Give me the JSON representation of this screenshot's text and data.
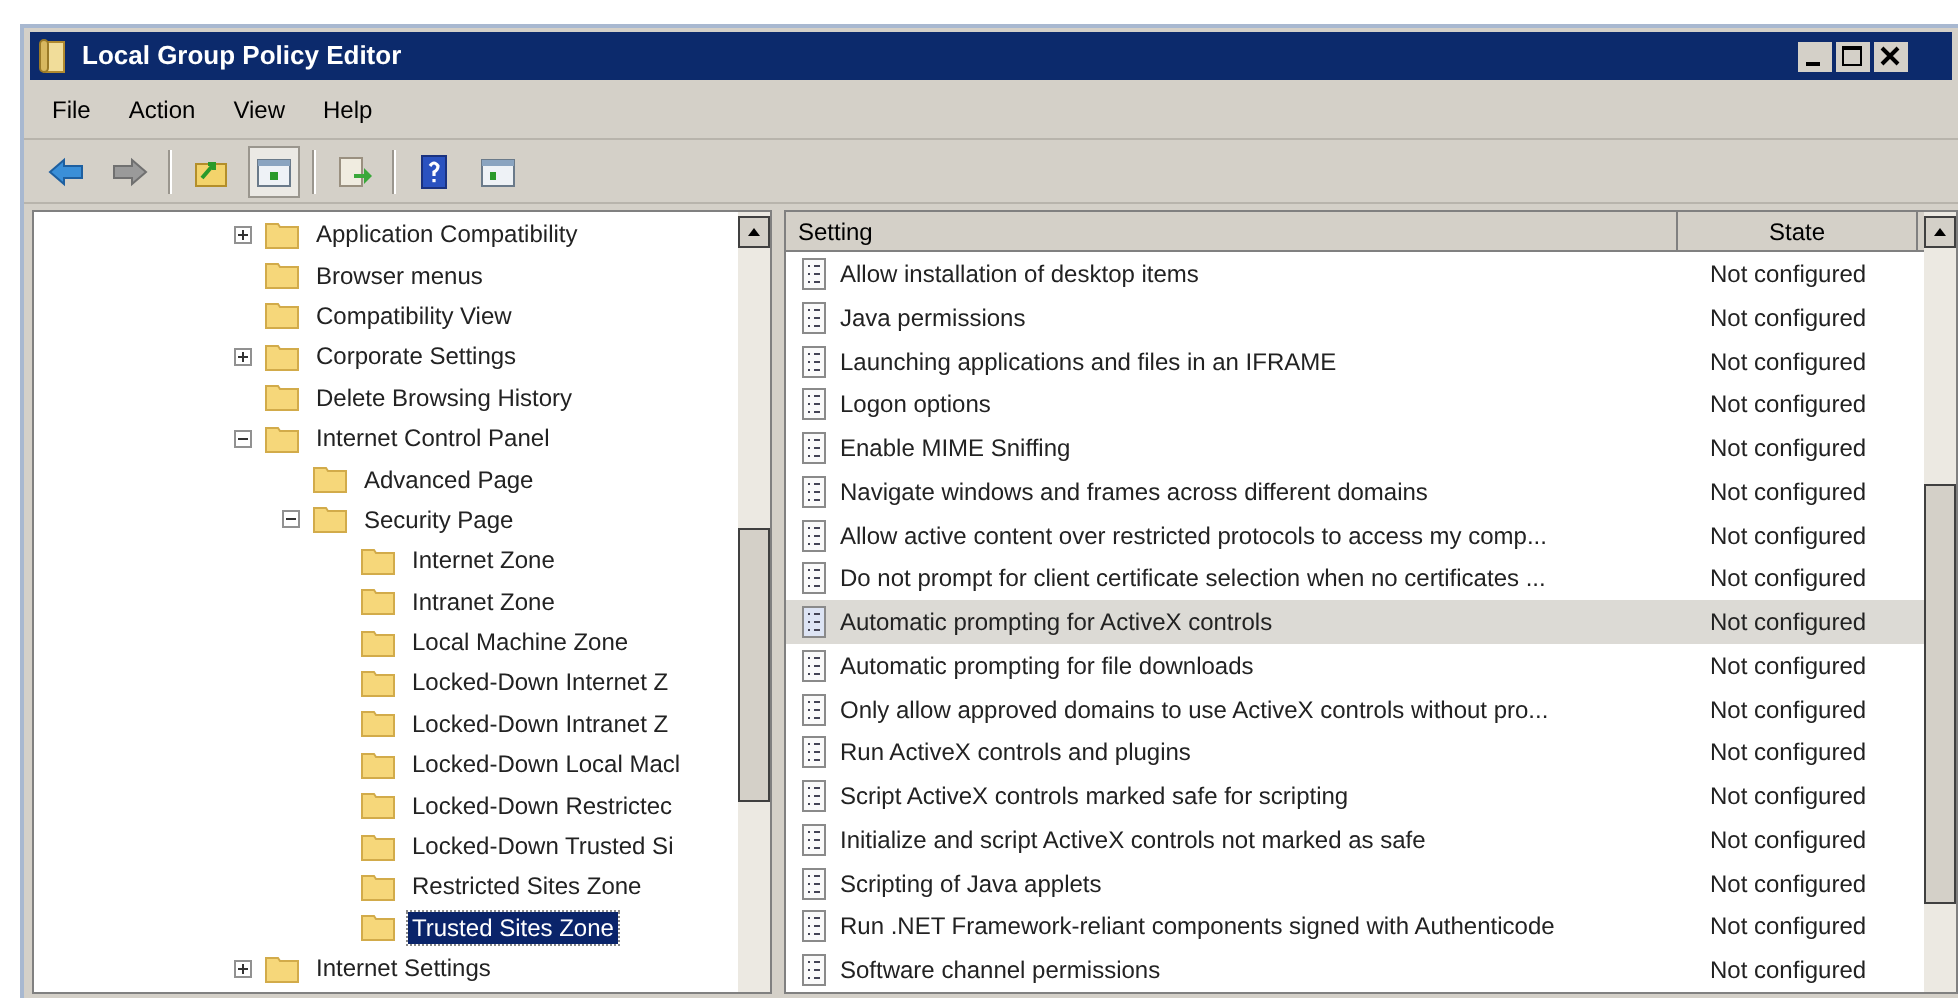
{
  "window": {
    "title": "Local Group Policy Editor"
  },
  "menu": [
    "File",
    "Action",
    "View",
    "Help"
  ],
  "toolbar": [
    {
      "kind": "back",
      "pressed": false
    },
    {
      "kind": "forward",
      "pressed": false
    },
    {
      "kind": "separator"
    },
    {
      "kind": "up",
      "pressed": false
    },
    {
      "kind": "tree",
      "pressed": true
    },
    {
      "kind": "separator"
    },
    {
      "kind": "export",
      "pressed": false
    },
    {
      "kind": "separator"
    },
    {
      "kind": "help",
      "pressed": false
    },
    {
      "kind": "pane",
      "pressed": false
    }
  ],
  "tree": [
    {
      "label": "Application Compatibility",
      "expanded": false,
      "selected": false
    },
    {
      "label": "Browser menus",
      "selected": false
    },
    {
      "label": "Compatibility View",
      "selected": false
    },
    {
      "label": "Corporate Settings",
      "expanded": false,
      "selected": false
    },
    {
      "label": "Delete Browsing History",
      "selected": false
    },
    {
      "label": "Internet Control Panel",
      "expanded": true,
      "selected": false,
      "children": [
        {
          "label": "Advanced Page",
          "selected": false
        },
        {
          "label": "Security Page",
          "expanded": true,
          "selected": false,
          "children": [
            {
              "label": "Internet Zone",
              "selected": false
            },
            {
              "label": "Intranet Zone",
              "selected": false
            },
            {
              "label": "Local Machine Zone",
              "selected": false
            },
            {
              "label": "Locked-Down Internet Z",
              "selected": false
            },
            {
              "label": "Locked-Down Intranet Z",
              "selected": false
            },
            {
              "label": "Locked-Down Local Macl",
              "selected": false
            },
            {
              "label": "Locked-Down Restrictec",
              "selected": false
            },
            {
              "label": "Locked-Down Trusted Si",
              "selected": false
            },
            {
              "label": "Restricted Sites Zone",
              "selected": false
            },
            {
              "label": "Trusted Sites Zone",
              "selected": true
            }
          ]
        }
      ]
    },
    {
      "label": "Internet Settings",
      "expanded": false,
      "selected": false
    }
  ],
  "table": {
    "columns": [
      "Setting",
      "State"
    ],
    "rows": [
      {
        "setting": "Allow installation of desktop items",
        "state": "Not configured",
        "selected": false
      },
      {
        "setting": "Java permissions",
        "state": "Not configured",
        "selected": false
      },
      {
        "setting": "Launching applications and files in an IFRAME",
        "state": "Not configured",
        "selected": false
      },
      {
        "setting": "Logon options",
        "state": "Not configured",
        "selected": false
      },
      {
        "setting": "Enable MIME Sniffing",
        "state": "Not configured",
        "selected": false
      },
      {
        "setting": "Navigate windows and frames across different domains",
        "state": "Not configured",
        "selected": false
      },
      {
        "setting": "Allow active content over restricted protocols to access my comp...",
        "state": "Not configured",
        "selected": false
      },
      {
        "setting": "Do not prompt for client certificate selection when no certificates ...",
        "state": "Not configured",
        "selected": false
      },
      {
        "setting": "Automatic prompting for ActiveX controls",
        "state": "Not configured",
        "selected": true
      },
      {
        "setting": "Automatic prompting for file downloads",
        "state": "Not configured",
        "selected": false
      },
      {
        "setting": "Only allow approved domains to use ActiveX controls without pro...",
        "state": "Not configured",
        "selected": false
      },
      {
        "setting": "Run ActiveX controls and plugins",
        "state": "Not configured",
        "selected": false
      },
      {
        "setting": "Script ActiveX controls marked safe for scripting",
        "state": "Not configured",
        "selected": false
      },
      {
        "setting": "Initialize and script ActiveX controls not marked as safe",
        "state": "Not configured",
        "selected": false
      },
      {
        "setting": "Scripting of Java applets",
        "state": "Not configured",
        "selected": false
      },
      {
        "setting": "Run .NET Framework-reliant components signed with Authenticode",
        "state": "Not configured",
        "selected": false
      },
      {
        "setting": "Software channel permissions",
        "state": "Not configured",
        "selected": false
      }
    ]
  }
}
